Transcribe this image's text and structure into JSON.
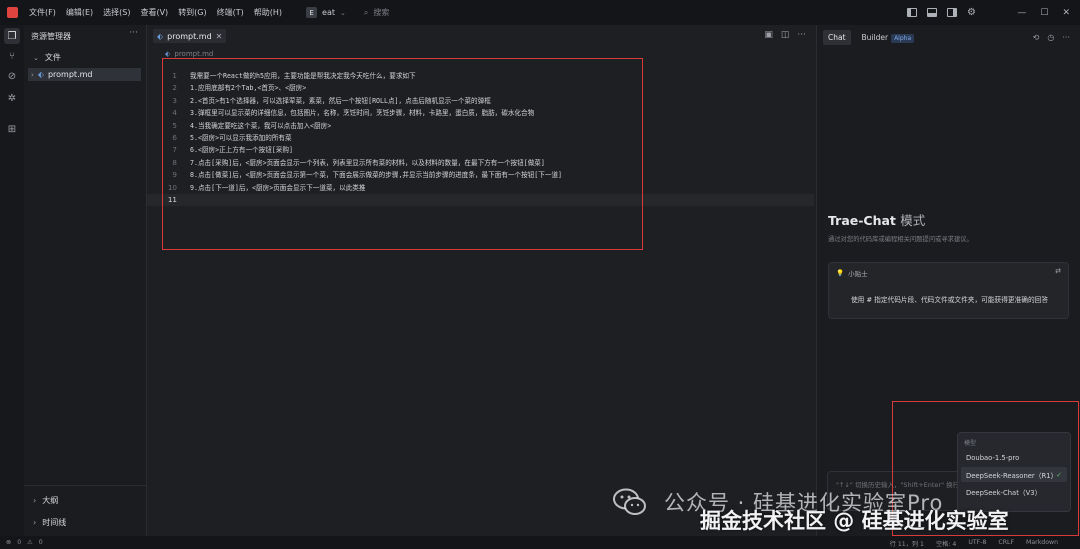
{
  "titlebar": {
    "menu": [
      "文件(F)",
      "编辑(E)",
      "选择(S)",
      "查看(V)",
      "转到(G)",
      "终端(T)",
      "帮助(H)"
    ],
    "project_badge": "E",
    "project_name": "eat",
    "search_placeholder": "搜索"
  },
  "sidebar": {
    "title": "资源管理器",
    "section_files": "文件",
    "file": "prompt.md",
    "section_outline": "大纲",
    "section_timeline": "时间线"
  },
  "editor": {
    "tab": "prompt.md",
    "breadcrumb": "prompt.md",
    "lines": [
      {
        "n": "1",
        "t": "我需要一个React做的h5应用，主要功能是帮我决定我今天吃什么，要求如下"
      },
      {
        "n": "2",
        "t": "1.应用底部有2个Tab,<首页>、<厨房>"
      },
      {
        "n": "3",
        "t": "2.<首页>有1个选择器，可以选择荤菜，素菜，然后一个按钮[ROLL点]，点击后随机显示一个菜的弹框"
      },
      {
        "n": "4",
        "t": "3.弹框里可以显示菜的详细信息，包括图片，名称，烹饪时间，烹饪步骤，材料，卡路里，蛋白质，脂肪，碳水化合物"
      },
      {
        "n": "5",
        "t": "4.当我确定要吃这个菜，我可以点击加入<厨房>"
      },
      {
        "n": "6",
        "t": "5.<厨房>可以显示我添加的所有菜"
      },
      {
        "n": "7",
        "t": "6.<厨房>正上方有一个按钮[采购]"
      },
      {
        "n": "8",
        "t": "7.点击[采购]后，<厨房>页面会显示一个列表，列表里显示所有菜的材料，以及材料的数量，在最下方有一个按钮[做菜]"
      },
      {
        "n": "9",
        "t": "8.点击[做菜]后，<厨房>页面会显示第一个菜，下面会展示做菜的步骤,并显示当前步骤的进度条，最下面有一个按钮[下一道]"
      },
      {
        "n": "10",
        "t": "9.点击[下一道]后，<厨房>页面会显示下一道菜，以此类推"
      },
      {
        "n": "11",
        "t": ""
      }
    ]
  },
  "chat": {
    "tab_chat": "Chat",
    "tab_builder": "Builder",
    "tab_builder_badge": "Alpha",
    "title": "Trae-Chat",
    "title_mode": "模式",
    "subtitle": "通过对您的代码库或编程相关问题提问或寻求建议。",
    "tip_label": "小贴士",
    "tip_text": "使用 # 指定代码片段、代码文件或文件夹，可能获得更准确的回答",
    "input_placeholder": "\"↑↓\" 切换历史输入，\"Shift+Enter\" 换行",
    "model_label": "模型",
    "models": [
      "Doubao-1.5-pro",
      "DeepSeek-Reasoner（R1）",
      "DeepSeek-Chat（V3）"
    ],
    "selected_model_index": 1
  },
  "watermark": {
    "line1": "公众号 · 硅基进化实验室Pro",
    "line2": "掘金技术社区 @ 硅基进化实验室"
  },
  "status": {
    "errors": "0",
    "warnings": "0",
    "position": "行 11，列 1",
    "spaces": "空格: 4",
    "encoding": "UTF-8",
    "eol": "CRLF",
    "language": "Markdown"
  },
  "colors": {
    "highlight_border": "#d63a3a",
    "accent": "#6b9bd8"
  }
}
